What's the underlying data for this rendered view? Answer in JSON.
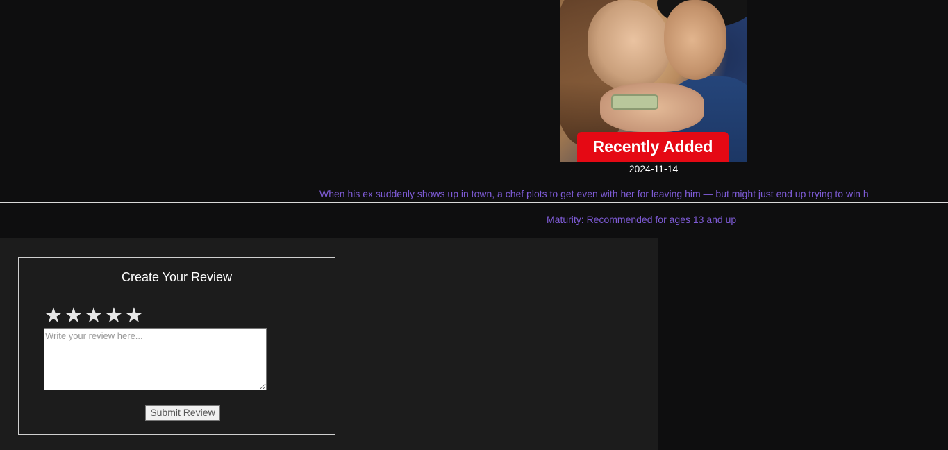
{
  "movie": {
    "badge": "Recently Added",
    "date": "2024-11-14",
    "description": "When his ex suddenly shows up in town, a chef plots to get even with her for leaving him — but might just end up trying to win h",
    "maturity": "Maturity: Recommended for ages 13 and up"
  },
  "review": {
    "title": "Create Your Review",
    "stars": [
      "★",
      "★",
      "★",
      "★",
      "★"
    ],
    "rating": 0,
    "placeholder": "Write your review here...",
    "text_value": "",
    "submit_label": "Submit Review"
  },
  "colors": {
    "background": "#0e0e0f",
    "panel": "#1c1c1c",
    "accent_text": "#7e5bd6",
    "badge": "#e50914"
  }
}
